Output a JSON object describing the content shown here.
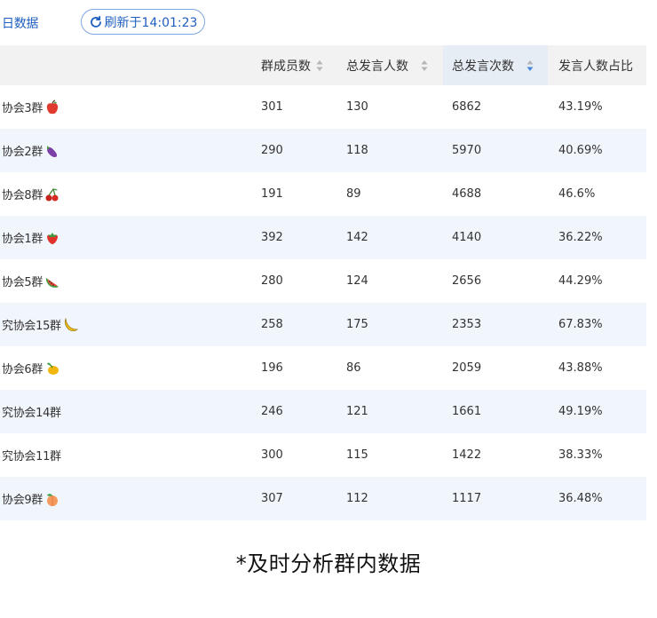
{
  "header": {
    "title": "日数据",
    "refresh_label": "刷新于14:01:23"
  },
  "table": {
    "columns": [
      "",
      "群成员数",
      "总发言人数",
      "总发言次数",
      "发言人数占比"
    ],
    "sorted_column": "总发言次数",
    "rows": [
      {
        "name": "协会3群",
        "prefix": "协",
        "fruit": "apple-icon",
        "members": "301",
        "speakers": "130",
        "messages": "6862",
        "ratio": "43.19%"
      },
      {
        "name": "协会2群",
        "prefix": "协",
        "fruit": "eggplant-icon",
        "members": "290",
        "speakers": "118",
        "messages": "5970",
        "ratio": "40.69%"
      },
      {
        "name": "协会8群",
        "prefix": "协",
        "fruit": "cherries-icon",
        "members": "191",
        "speakers": "89",
        "messages": "4688",
        "ratio": "46.6%"
      },
      {
        "name": "协会1群",
        "prefix": "协",
        "fruit": "strawberry-icon",
        "members": "392",
        "speakers": "142",
        "messages": "4140",
        "ratio": "36.22%"
      },
      {
        "name": "协会5群",
        "prefix": "协",
        "fruit": "watermelon-icon",
        "members": "280",
        "speakers": "124",
        "messages": "2656",
        "ratio": "44.29%"
      },
      {
        "name": "究协会15群",
        "prefix": "",
        "fruit": "banana-icon",
        "members": "258",
        "speakers": "175",
        "messages": "2353",
        "ratio": "67.83%"
      },
      {
        "name": "协会6群",
        "prefix": "协",
        "fruit": "mango-icon",
        "members": "196",
        "speakers": "86",
        "messages": "2059",
        "ratio": "43.88%"
      },
      {
        "name": "究协会14群",
        "prefix": "",
        "fruit": "",
        "members": "246",
        "speakers": "121",
        "messages": "1661",
        "ratio": "49.19%"
      },
      {
        "name": "究协会11群",
        "prefix": "",
        "fruit": "",
        "members": "300",
        "speakers": "115",
        "messages": "1422",
        "ratio": "38.33%"
      },
      {
        "name": "协会9群",
        "prefix": "协",
        "fruit": "peach-icon",
        "members": "307",
        "speakers": "112",
        "messages": "1117",
        "ratio": "36.48%"
      }
    ]
  },
  "caption": "*及时分析群内数据",
  "colors": {
    "accent": "#1f5fbf",
    "row_alt": "#f1f5fc",
    "header_bg": "#f2f2f2",
    "sort_active": "#4a86d8"
  }
}
